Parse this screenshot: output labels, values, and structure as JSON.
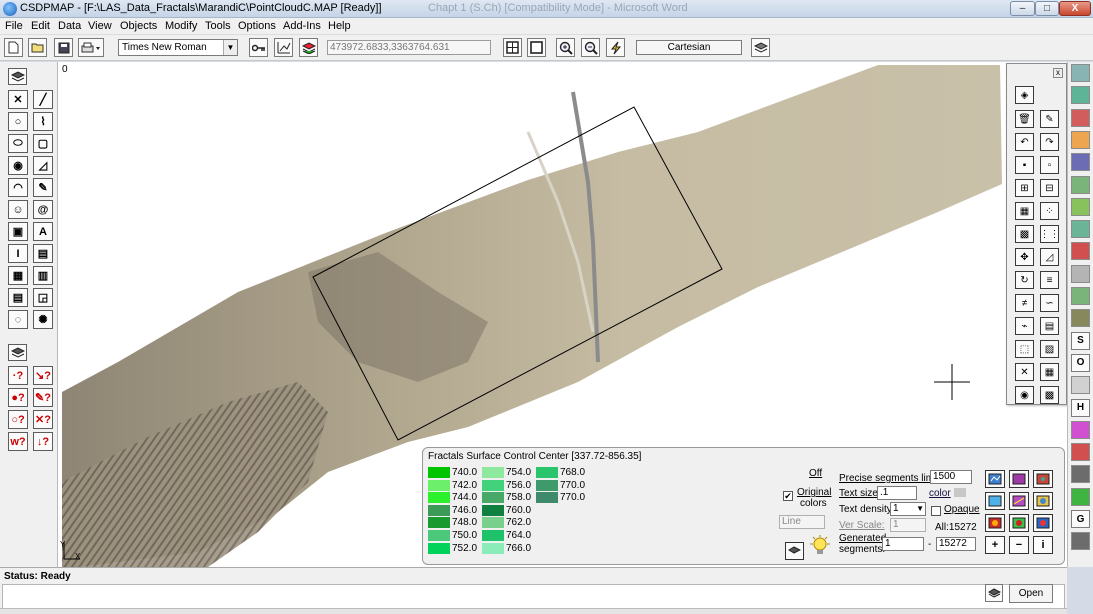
{
  "window": {
    "title": "CSDPMAP - [F:\\LAS_Data_Fractals\\MarandiC\\PointCloudC.MAP [Ready]]",
    "ghost_title": "Chapt 1 (S.Ch) [Compatibility Mode] - Microsoft Word",
    "min_label": "–",
    "max_label": "□",
    "close_label": "X"
  },
  "menu": [
    "File",
    "Edit",
    "Data",
    "View",
    "Objects",
    "Modify",
    "Tools",
    "Options",
    "Add-Ins",
    "Help"
  ],
  "toolbar": {
    "font_name": "Times New Roman",
    "coordinates": "473972.6833,3363764.631",
    "projection": "Cartesian"
  },
  "canvas": {
    "origin_label": "0",
    "axis_y": "Y",
    "axis_x": "X",
    "colors": {
      "field_light": "#c9bfa6",
      "field_dark": "#8f8573",
      "road": "#9b9b9b",
      "rect_border": "#000000"
    }
  },
  "left_toolbar": {
    "buttons_upper": [
      "select-icon",
      "line-icon",
      "circle-icon",
      "polyline-icon",
      "ellipse-icon",
      "rounded-rect-icon",
      "ring-icon",
      "polygon-icon",
      "arc-icon",
      "freehand-icon",
      "symbol-icon",
      "spiral-icon",
      "image-icon",
      "text-icon",
      "vertical-text-icon",
      "multiline-text-icon",
      "layer-icon",
      "table-icon",
      "building-icon",
      "graph-icon",
      "point-icon",
      "target-icon"
    ],
    "buttons_lower": [
      "properties-icon",
      "query-point-icon",
      "query-line-icon",
      "query-fill-icon",
      "query-color-icon",
      "query-order-icon",
      "query-delete-icon",
      "query-width-icon",
      "query-sort-icon"
    ],
    "question_labels": [
      "·?",
      "↘?",
      "●?",
      "✎?",
      "○?",
      "✕?",
      "w?",
      "↓?"
    ]
  },
  "float_panel": {
    "close_label": "x",
    "buttons": [
      "properties-icon",
      "delete-icon",
      "paint-icon",
      "undo-icon",
      "redo-icon",
      "copy-icon",
      "paste-icon",
      "group-icon",
      "ungroup-icon",
      "align-icon",
      "scatter-icon",
      "bring-front-icon",
      "grid-icon",
      "move-icon",
      "resize-icon",
      "rotate-icon",
      "notes-icon",
      "not-equal-icon",
      "curve-icon",
      "line-chart-icon",
      "report-icon",
      "map-icon",
      "frame-icon",
      "cross-icon",
      "calculator-icon",
      "globe-icon",
      "save-icon"
    ]
  },
  "right_strip": {
    "buttons": [
      "tiles-icon",
      "coords-icon",
      "layers-icon",
      "warning-icon",
      "chart-icon",
      "grid-map-icon",
      "hatch-icon",
      "triangulation-icon",
      "color-map-icon",
      "pattern-icon",
      "area-chart-icon",
      "measure-icon",
      "S",
      "O",
      "contour-icon",
      "H",
      "palette-icon",
      "blob-icon",
      "goal-icon",
      "export-icon",
      "G",
      "properties-icon"
    ]
  },
  "fractal_panel": {
    "title": "Fractals Surface Control Center [337.72-856.35]",
    "colors": [
      {
        "value": "740.0",
        "color": "#00c400"
      },
      {
        "value": "742.0",
        "color": "#6cf06c"
      },
      {
        "value": "744.0",
        "color": "#2bf02b"
      },
      {
        "value": "746.0",
        "color": "#3a9a56"
      },
      {
        "value": "748.0",
        "color": "#1a9a2e"
      },
      {
        "value": "750.0",
        "color": "#4cc87a"
      },
      {
        "value": "752.0",
        "color": "#00d25a"
      },
      {
        "value": "754.0",
        "color": "#8ee89e"
      },
      {
        "value": "756.0",
        "color": "#42d27c"
      },
      {
        "value": "758.0",
        "color": "#48a868"
      },
      {
        "value": "760.0",
        "color": "#108040"
      },
      {
        "value": "762.0",
        "color": "#78d08c"
      },
      {
        "value": "764.0",
        "color": "#1ec26a"
      },
      {
        "value": "766.0",
        "color": "#8aecb8"
      },
      {
        "value": "768.0",
        "color": "#2ac46c"
      },
      {
        "value": "770.0",
        "color": "#3e9a6a"
      },
      {
        "value": "770.0",
        "color": "#3e8a6a"
      }
    ],
    "off_label": "Off",
    "original_colors_label_1": "Original",
    "original_colors_label_2": "colors",
    "original_colors_checked": "✔",
    "line_mode": "Line",
    "precise_label": "Precise segments limit:",
    "precise_value": "1500",
    "text_size_label": "Text size:",
    "text_size_value": ".1",
    "color_label": "color",
    "text_density_label": "Text density:",
    "text_density_value": "1",
    "opaque_label": "Opaque",
    "ver_scale_label": "Ver Scale:",
    "ver_scale_value": "1",
    "all_label": "All:15272",
    "generated_label_1": "Generated",
    "generated_label_2": "segments:",
    "generated_from": "1",
    "generated_sep": "-",
    "generated_to": "15272",
    "plus_label": "+",
    "minus_label": "−",
    "info_label": "i"
  },
  "status": {
    "text": "Status: Ready",
    "open_label": "Open"
  }
}
